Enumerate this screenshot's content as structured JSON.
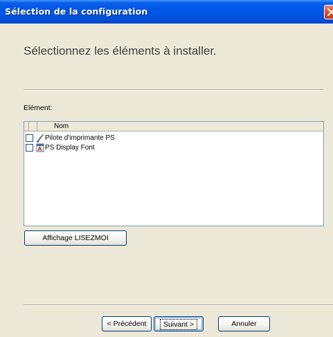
{
  "window": {
    "title": "Sélection de la configuration"
  },
  "heading": "Sélectionnez les éléments à installer.",
  "list": {
    "label": "Elément:",
    "column_header": "Nom",
    "items": [
      {
        "label": "Pilote d'imprimante PS",
        "icon": "printer-driver-icon",
        "checked": false
      },
      {
        "label": "PS Display Font",
        "icon": "font-icon",
        "checked": false
      }
    ]
  },
  "buttons": {
    "readme": "Affichage LISEZMOI",
    "previous": "< Précédent",
    "next": "Suivant >",
    "cancel": "Annuler"
  },
  "colors": {
    "titlebar": "#0058e6",
    "window_bg": "#ece9d8",
    "close_button": "#e0502c"
  }
}
